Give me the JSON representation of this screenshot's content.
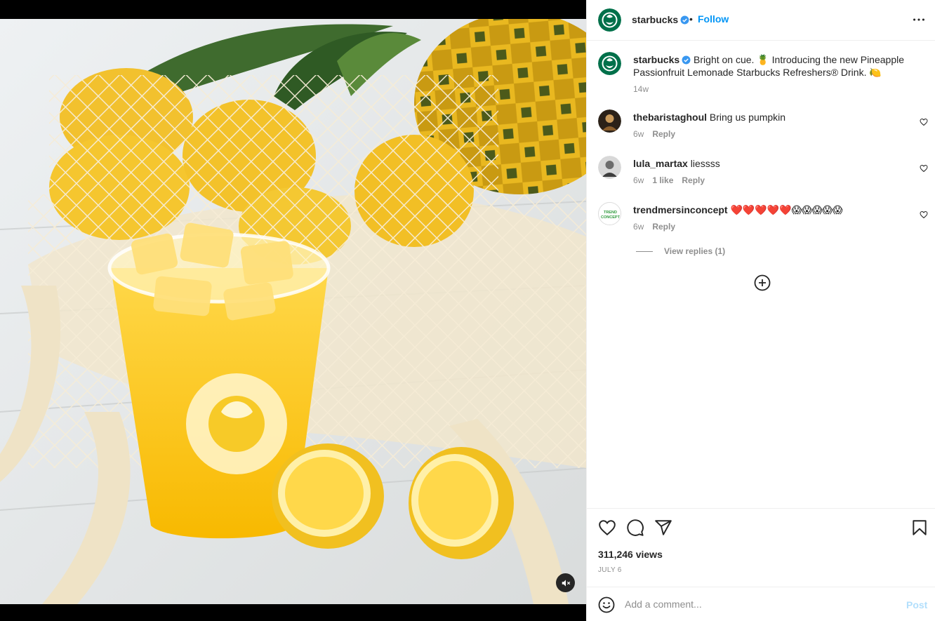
{
  "post": {
    "author": "starbucks",
    "follow_label": "Follow",
    "separator": "•",
    "caption": "Bright on cue. 🍍 Introducing the new Pineapple Passionfruit Lemonade Starbucks Refreshers® Drink. 🍋",
    "caption_age": "14w",
    "views": "311,246 views",
    "date": "JULY 6"
  },
  "media": {
    "description_icon": "mute-icon",
    "muted": true
  },
  "comments": [
    {
      "user": "thebaristaghoul",
      "text": "Bring us pumpkin",
      "age": "6w",
      "likes": "",
      "reply_label": "Reply"
    },
    {
      "user": "lula_martax",
      "text": "liessss",
      "age": "6w",
      "likes": "1 like",
      "reply_label": "Reply"
    },
    {
      "user": "trendmersinconcept",
      "text": "❤️❤️❤️❤️❤️😱😱😱😱😱",
      "age": "6w",
      "likes": "",
      "reply_label": "Reply",
      "view_replies": "View replies (1)"
    }
  ],
  "composer": {
    "placeholder": "Add a comment...",
    "post_label": "Post"
  },
  "avatar_badge_text": "TREND CONCEPT",
  "colors": {
    "link": "#0095f6",
    "brand_green": "#00704A",
    "verified": "#3897f0",
    "post_disabled": "#b2dffc",
    "heart_red": "#e0245e"
  }
}
